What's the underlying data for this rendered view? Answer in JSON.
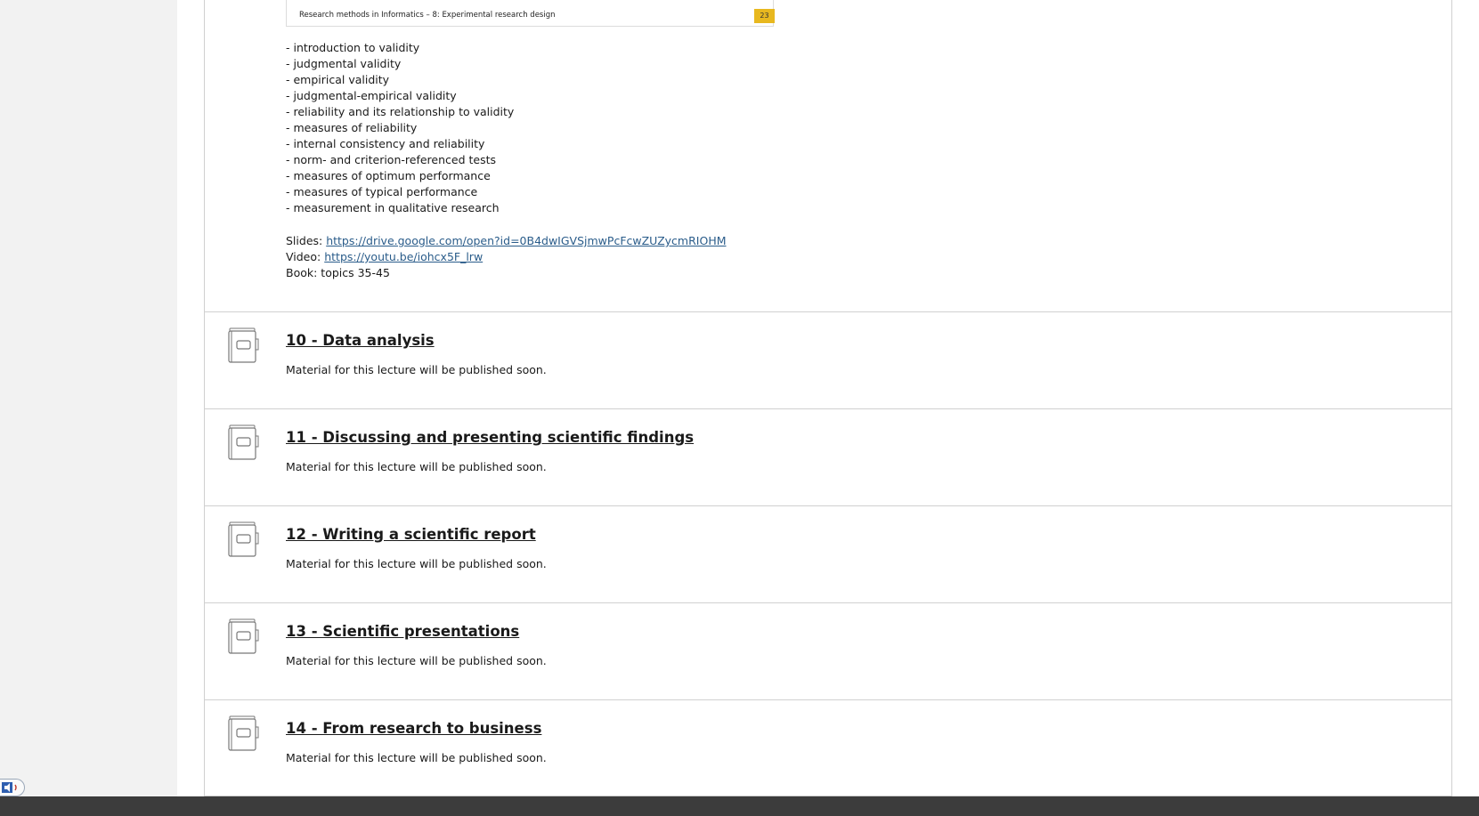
{
  "slide": {
    "caption": "Research methods in Informatics – 8: Experimental research design",
    "page_number": "23"
  },
  "topics": [
    "- introduction to validity",
    "- judgmental validity",
    "- empirical validity",
    "- judgmental-empirical validity",
    "- reliability and its relationship to validity",
    "- measures of reliability",
    "- internal consistency and reliability",
    "- norm- and criterion-referenced tests",
    "- measures of optimum performance",
    "- measures of typical performance",
    "- measurement in qualitative research"
  ],
  "resources": {
    "slides_label": "Slides: ",
    "slides_link": "https://drive.google.com/open?id=0B4dwIGVSjmwPcFcwZUZycmRIOHM",
    "video_label": "Video: ",
    "video_link": "https://youtu.be/iohcx5F_lrw",
    "book": "Book: topics 35-45"
  },
  "sections": [
    {
      "title": "10 - Data analysis",
      "desc": "Material for this lecture will be published soon."
    },
    {
      "title": "11 - Discussing and presenting scientific findings",
      "desc": "Material for this lecture will be published soon."
    },
    {
      "title": "12 - Writing a scientific report",
      "desc": "Material for this lecture will be published soon."
    },
    {
      "title": "13 - Scientific presentations",
      "desc": "Material for this lecture will be published soon."
    },
    {
      "title": "14 - From research to business",
      "desc": "Material for this lecture will be published soon."
    }
  ],
  "icons": {
    "section_icon": "book-icon",
    "corner_icon": "text-to-speech-icon"
  },
  "colors": {
    "badge": "#e8b81f",
    "link": "#2a5c8a"
  }
}
